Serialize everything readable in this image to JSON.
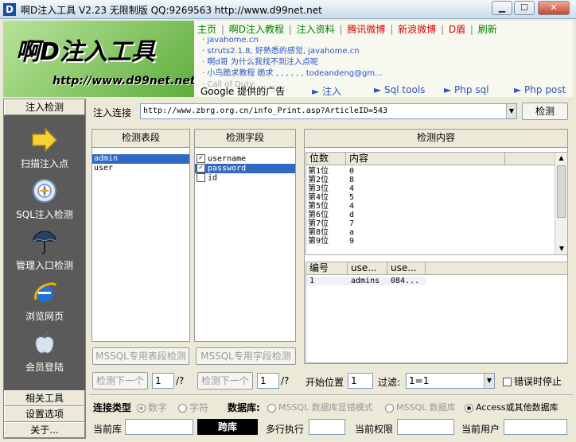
{
  "window": {
    "title": "啊D注入工具 V2.23 无限制版 QQ:9269563 http://www.d99net.net",
    "icon_letter": "D",
    "min_glyph": "▁",
    "max_glyph": "☐",
    "close_glyph": "✕"
  },
  "banner": {
    "logo": "啊D注入工具",
    "url": "http://www.d99net.net",
    "nav": [
      "主页",
      "|",
      "啊D注入教程",
      "|",
      "注入资料",
      "|",
      "腾讯微博",
      "|",
      "新浪微博",
      "|",
      "D盾",
      "|",
      "刷新"
    ],
    "ticker": [
      "· javahome.cn",
      "· struts2.1.8, 好熟悉的感觉, javahome.cn",
      "· 啊d哥 为什么我找不到注入点呢",
      "· 小鸟跪求教程 跪求 , , , , , , todeandeng@gm...",
      "· Call of Duty: ... ... ..."
    ],
    "google_ad": "Google 提供的广告",
    "tools": [
      "► 注入",
      "► Sql tools",
      "► Php sql",
      "► Php post"
    ]
  },
  "sidebar": {
    "header": "注入检测",
    "items": [
      {
        "label": "扫描注入点",
        "icon": "arrow-right-icon"
      },
      {
        "label": "SQL注入检测",
        "icon": "target-icon"
      },
      {
        "label": "管理入口检测",
        "icon": "umbrella-icon"
      },
      {
        "label": "浏览网页",
        "icon": "ie-icon"
      },
      {
        "label": "会员登陆",
        "icon": "apple-icon"
      }
    ],
    "bottom": [
      "相关工具",
      "设置选项",
      "关于..."
    ]
  },
  "main": {
    "url_label": "注入连接",
    "url_value": "http://www.zbrg.org.cn/info_Print.asp?ArticleID=543",
    "detect_btn": "检测",
    "tables_header": "检测表段",
    "tables": [
      {
        "name": "admin",
        "selected": true
      },
      {
        "name": "user",
        "selected": false
      }
    ],
    "fields_header": "检测字段",
    "fields": [
      {
        "name": "username",
        "checked": true,
        "selected": false
      },
      {
        "name": "password",
        "checked": true,
        "selected": true
      },
      {
        "name": "id",
        "checked": false,
        "selected": false
      }
    ],
    "content_header": "检测内容",
    "content_cols": [
      "位数",
      "内容"
    ],
    "content_rows": [
      [
        "第1位",
        "0"
      ],
      [
        "第2位",
        "8"
      ],
      [
        "第3位",
        "4"
      ],
      [
        "第4位",
        "5"
      ],
      [
        "第5位",
        "4"
      ],
      [
        "第6位",
        "d"
      ],
      [
        "第7位",
        "7"
      ],
      [
        "第8位",
        "a"
      ],
      [
        "第9位",
        "9"
      ]
    ],
    "result_cols": [
      "编号",
      "use...",
      "use..."
    ],
    "result_rows": [
      [
        "1",
        "admins",
        "084..."
      ]
    ],
    "mssql_table_btn": "MSSQL专用表段检测",
    "mssql_field_btn": "MSSQL专用字段检测",
    "next_btn_1": "检测下一个",
    "next_val_1": "1",
    "next_btn_2": "检测下一个",
    "next_val_2": "1",
    "slash_q": "/?",
    "start_label": "开始位置",
    "start_val": "1",
    "filter_label": "过滤:",
    "filter_val": "1=1",
    "stop_on_error": "错误时停止"
  },
  "bottom": {
    "conn_type_label": "连接类型",
    "conn_types": [
      "数字",
      "字符"
    ],
    "db_label": "数据库:",
    "db_options": [
      "MSSQL 数据库显错模式",
      "MSSQL 数据库",
      "Access或其他数据库"
    ],
    "current_db_label": "当前库",
    "cross_btn": "跨库",
    "multi_exec_label": "多行执行",
    "perm_label": "当前权限",
    "user_label": "当前用户"
  }
}
